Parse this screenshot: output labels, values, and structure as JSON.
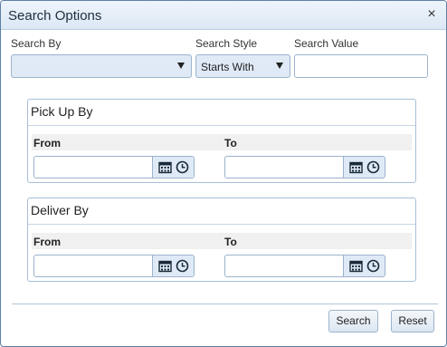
{
  "dialog": {
    "title": "Search Options",
    "close_glyph": "×"
  },
  "search": {
    "by_label": "Search By",
    "by_value": "",
    "style_label": "Search Style",
    "style_value": "Starts With",
    "value_label": "Search Value",
    "value_value": ""
  },
  "pickup": {
    "title": "Pick Up By",
    "from_label": "From",
    "to_label": "To",
    "from_value": "",
    "to_value": ""
  },
  "deliver": {
    "title": "Deliver By",
    "from_label": "From",
    "to_label": "To",
    "from_value": "",
    "to_value": ""
  },
  "footer": {
    "search_label": "Search",
    "reset_label": "Reset"
  },
  "icons": {
    "calendar": "calendar-icon",
    "clock": "clock-icon",
    "close": "close-icon",
    "dropdown": "chevron-down-icon"
  },
  "colors": {
    "accent": "#1f4e8c",
    "border": "#9cb3cc",
    "field_bg": "#dfeaf6"
  }
}
